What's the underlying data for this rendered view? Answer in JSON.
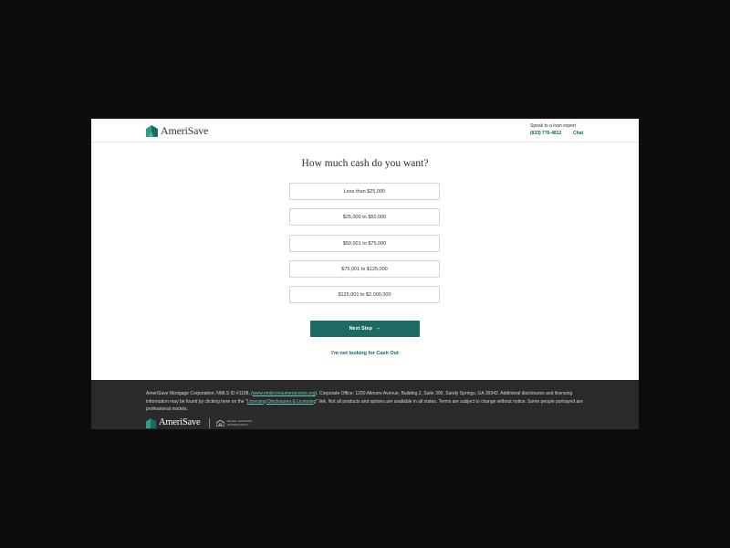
{
  "header": {
    "brand": "AmeriSave",
    "speak_label": "Speak to a loan expert",
    "phone": "(833) 776-4812",
    "chat_label": "Chat"
  },
  "main": {
    "question": "How much cash do you want?",
    "options": [
      "Less than $25,000",
      "$25,000 to $50,000",
      "$50,001 to $75,000",
      "$75,001 to $125,000",
      "$125,001 to $2,000,000"
    ],
    "next_label": "Next Step",
    "next_arrow": "→",
    "no_cash_label": "I'm not looking for Cash Out"
  },
  "footer": {
    "legal_part1": "AmeriSave Mortgage Corporation, NMLS ID #1168, (",
    "nmls_link": "www.nmlsconsumeraccess.org",
    "legal_part2": "). Corporate Office: 1200 Altmore Avenue, Building 2, Suite 300, Sandy Springs, GA 30342. Additional disclosures and licensing information may be found by clicking here on the \"",
    "licensing_link": "Licensing Disclosures & Licensing",
    "legal_part3": "\" link. Not all products and options are available in all states. Terms are subject to change without notice. Some people portrayed are professional models.",
    "brand": "AmeriSave",
    "equal_housing_line1": "EQUAL HOUSING",
    "equal_housing_line2": "OPPORTUNITY"
  },
  "colors": {
    "brand_teal": "#1c6b62",
    "link_teal": "#0b6b63",
    "footer_bg": "#2a2a2a",
    "page_backdrop": "#0d0d0d"
  },
  "icons": {
    "logo": "amerisave-house-icon",
    "next_arrow": "arrow-right-icon",
    "equal_housing": "equal-housing-icon"
  }
}
